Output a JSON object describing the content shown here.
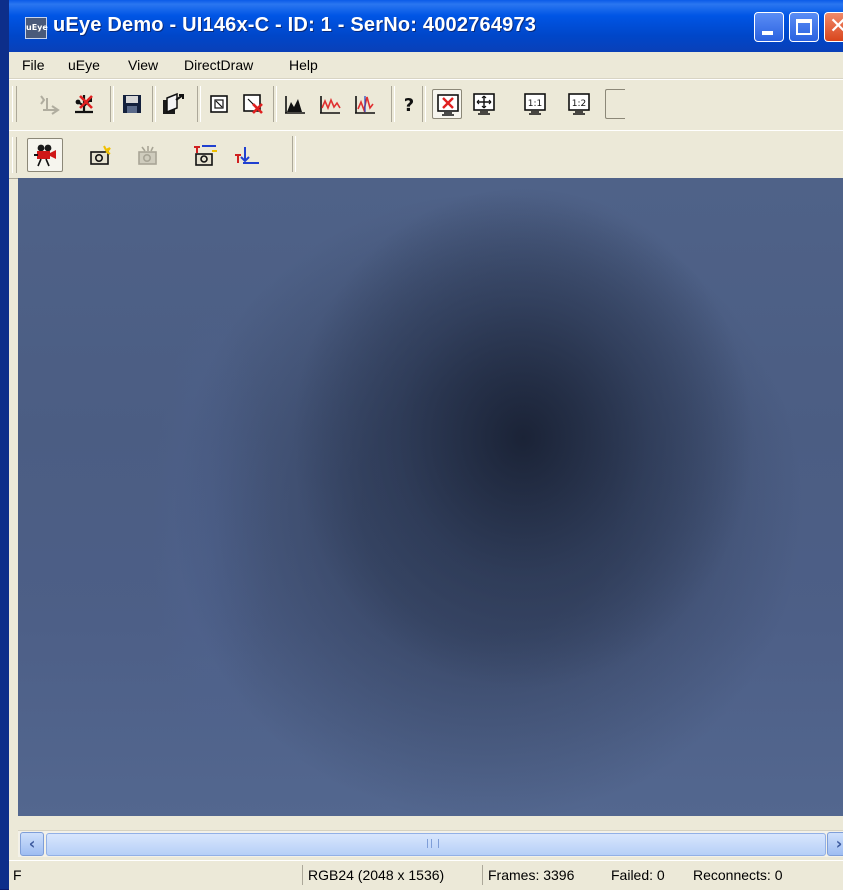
{
  "window": {
    "app_icon_label": "uEye",
    "title": "uEye Demo - UI146x-C - ID: 1 - SerNo: 4002764973",
    "buttons": {
      "minimize": "minimize",
      "maximize": "maximize",
      "close": "✕"
    }
  },
  "menu": {
    "items": [
      {
        "label": "File"
      },
      {
        "label": "uEye"
      },
      {
        "label": "View"
      },
      {
        "label": "DirectDraw"
      },
      {
        "label": "Help"
      }
    ]
  },
  "toolbar1": {
    "buttons": [
      {
        "icon": "camera-network-icon",
        "enabled": false
      },
      {
        "icon": "usb-disconnect-icon"
      },
      {
        "icon": "save-floppy-icon"
      },
      {
        "icon": "load-parameters-icon"
      },
      {
        "icon": "aoi-icon"
      },
      {
        "icon": "aoi-delete-icon"
      },
      {
        "icon": "histogram-icon"
      },
      {
        "icon": "line-profile-icon"
      },
      {
        "icon": "column-profile-icon"
      },
      {
        "icon": "help-icon"
      },
      {
        "icon": "fit-window-icon",
        "pressed": true
      },
      {
        "icon": "center-view-icon"
      },
      {
        "icon": "zoom-1-1-icon",
        "text": "1:1"
      },
      {
        "icon": "zoom-1-2-icon",
        "text": "1:2"
      }
    ]
  },
  "toolbar2": {
    "buttons": [
      {
        "icon": "live-video-icon",
        "pressed": true
      },
      {
        "icon": "snapshot-icon"
      },
      {
        "icon": "snapshot-disabled-icon",
        "enabled": false
      },
      {
        "icon": "trigger-snapshot-icon"
      },
      {
        "icon": "trigger-icon"
      }
    ]
  },
  "statusbar": {
    "left_text": "F",
    "format": "RGB24 (2048 x 1536)",
    "frames": "Frames: 3396",
    "failed": "Failed: 0",
    "reconnects": "Reconnects: 0"
  },
  "colors": {
    "title_blue": "#0055e5",
    "chrome": "#ece9d8",
    "image_tint": "#4d5f87"
  }
}
